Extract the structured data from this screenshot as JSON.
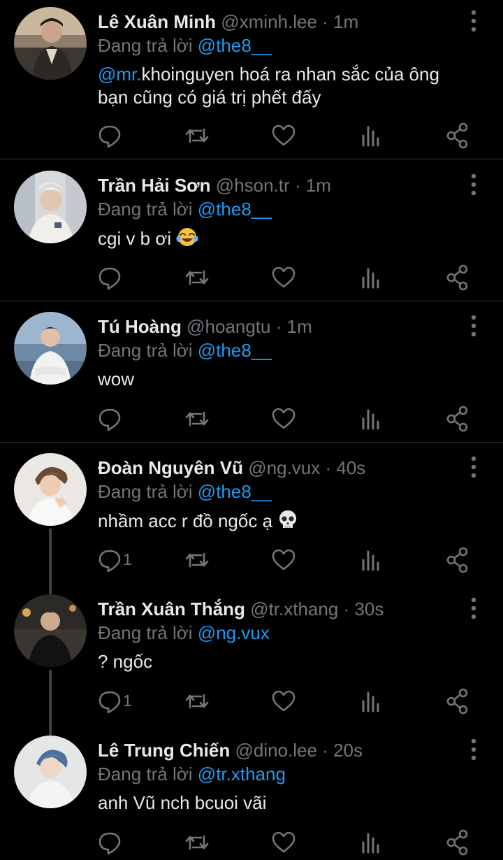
{
  "tweets": [
    {
      "name": "Lê Xuân Minh",
      "handle": "@xminh.lee",
      "time": "· 1m",
      "reply_prefix": "Đang trả lời",
      "reply_to": "@the8__",
      "content_mention": "@mr.",
      "content_line1": "khoinguyen hoá ra nhan sắc của ông",
      "content_line2": "bạn cũng có giá trị phết đấy",
      "reply_count": ""
    },
    {
      "name": "Trần Hải Sơn",
      "handle": "@hson.tr",
      "time": "· 1m",
      "reply_prefix": "Đang trả lời",
      "reply_to": "@the8__",
      "content": "cgi v b ơi",
      "emoji": "tears-of-joy-emoji",
      "reply_count": ""
    },
    {
      "name": "Tú Hoàng",
      "handle": "@hoangtu",
      "time": "· 1m",
      "reply_prefix": "Đang trả lời",
      "reply_to": "@the8__",
      "content": "wow",
      "reply_count": ""
    },
    {
      "name": "Đoàn Nguyên Vũ",
      "handle": "@ng.vux",
      "time": "· 40s",
      "reply_prefix": "Đang trả lời",
      "reply_to": "@the8__",
      "content": "nhầm acc r đồ ngốc ạ",
      "emoji": "skull-emoji",
      "reply_count": "1"
    },
    {
      "name": "Trần Xuân Thắng",
      "handle": "@tr.xthang",
      "time": "· 30s",
      "reply_prefix": "Đang trả lời",
      "reply_to": "@ng.vux",
      "content": "? ngốc",
      "reply_count": "1"
    },
    {
      "name": "Lê Trung Chiến",
      "handle": "@dino.lee",
      "time": "· 20s",
      "reply_prefix": "Đang trả lời",
      "reply_to": "@tr.xthang",
      "content": "anh Vũ nch bcuoi vãi",
      "reply_count": ""
    }
  ],
  "icons": {
    "reply": "speech-bubble-icon",
    "retweet": "retweet-icon",
    "like": "heart-icon",
    "views": "bar-chart-icon",
    "share": "share-icon",
    "more": "vertical-dots-icon"
  },
  "colors": {
    "background": "#000000",
    "text": "#e7e9ea",
    "muted": "#71767b",
    "link": "#1d9bf0",
    "divider": "#2f3336"
  }
}
